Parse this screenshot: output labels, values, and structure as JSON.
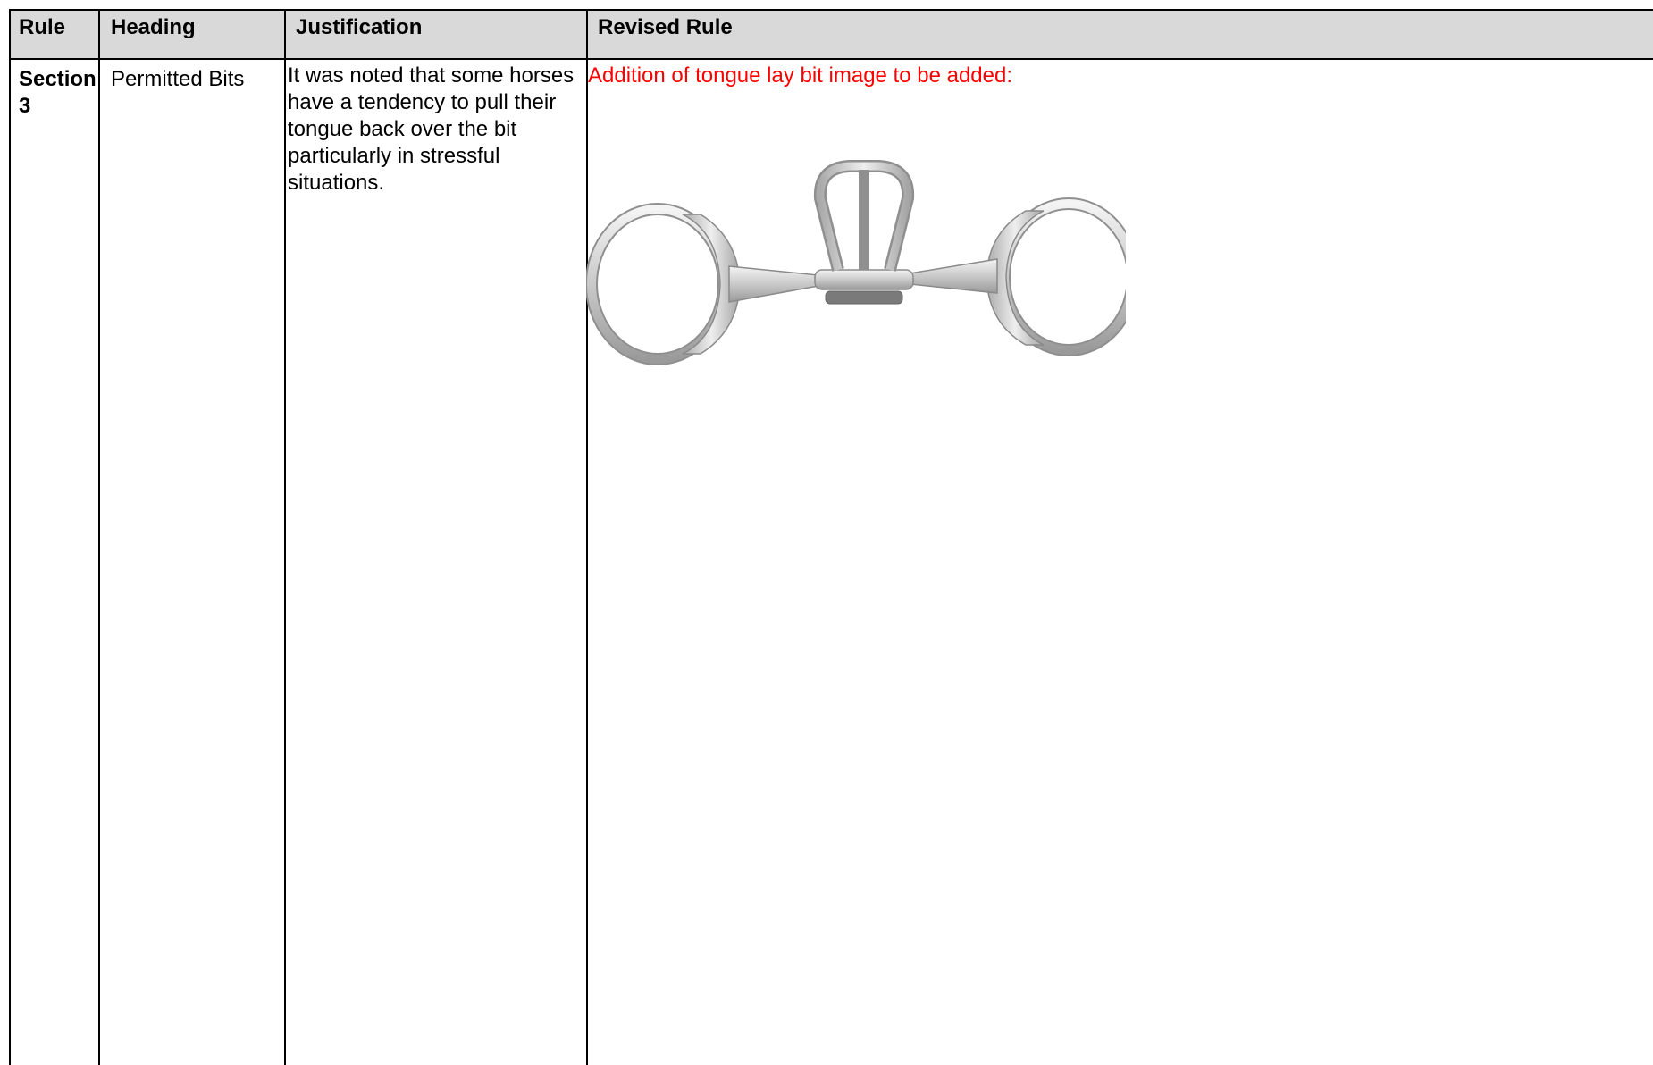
{
  "table": {
    "headers": {
      "rule": "Rule",
      "heading": "Heading",
      "justification": "Justification",
      "revised_rule": "Revised Rule"
    },
    "rows": [
      {
        "rule": "Section 3",
        "heading": "Permitted Bits",
        "justification": "It was noted that some horses have a tendency to pull their tongue back over the bit particularly in stressful situations.",
        "revised_rule": "Addition of tongue lay bit image to be added:"
      }
    ]
  },
  "image": {
    "subject": "eggbutt snaffle bit with tongue lay plate",
    "metal_color": "#c9c9c9"
  },
  "colors": {
    "header_bg": "#d9d9d9",
    "revised_text": "#ff0000",
    "border": "#000000"
  }
}
